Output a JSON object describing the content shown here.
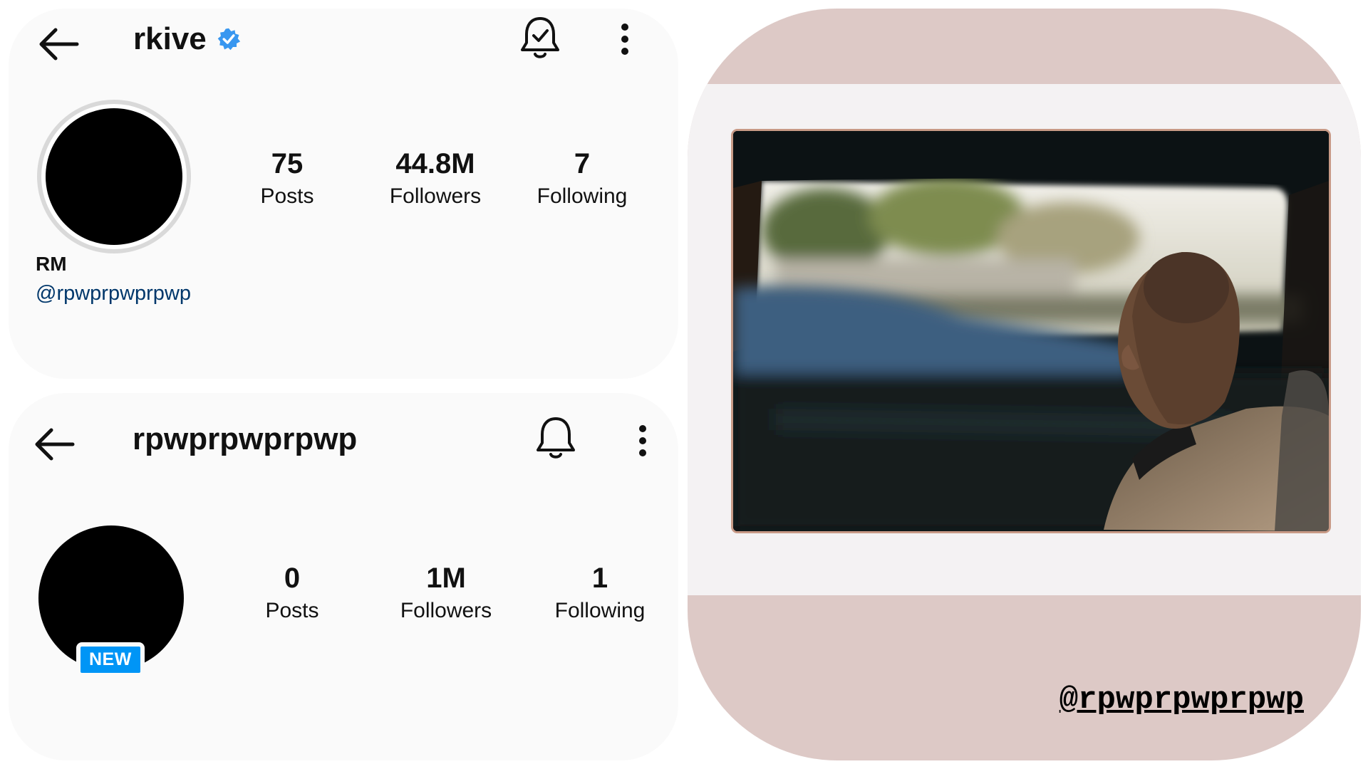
{
  "profile_top": {
    "username": "rkive",
    "verified": true,
    "display_name": "RM",
    "mention": "@rpwprpwprpwp",
    "stats": [
      {
        "value": "75",
        "label": "Posts"
      },
      {
        "value": "44.8M",
        "label": "Followers"
      },
      {
        "value": "7",
        "label": "Following"
      }
    ],
    "icons": {
      "back": "back-arrow-icon",
      "notify": "bell-check-icon",
      "menu": "more-vertical-icon"
    }
  },
  "profile_bottom": {
    "username": "rpwprpwprpwp",
    "badge": "NEW",
    "stats": [
      {
        "value": "0",
        "label": "Posts"
      },
      {
        "value": "1M",
        "label": "Followers"
      },
      {
        "value": "1",
        "label": "Following"
      }
    ],
    "icons": {
      "back": "back-arrow-icon",
      "notify": "bell-icon",
      "menu": "more-vertical-icon"
    }
  },
  "photo": {
    "caption": "@rpwprpwprpwp",
    "description_colors": {
      "panel": "#ddc9c6",
      "paper": "#f4f2f3",
      "frame": "#0c1214"
    }
  },
  "colors": {
    "verified": "#3897f0",
    "link": "#00376b",
    "new_badge": "#0095f6"
  }
}
